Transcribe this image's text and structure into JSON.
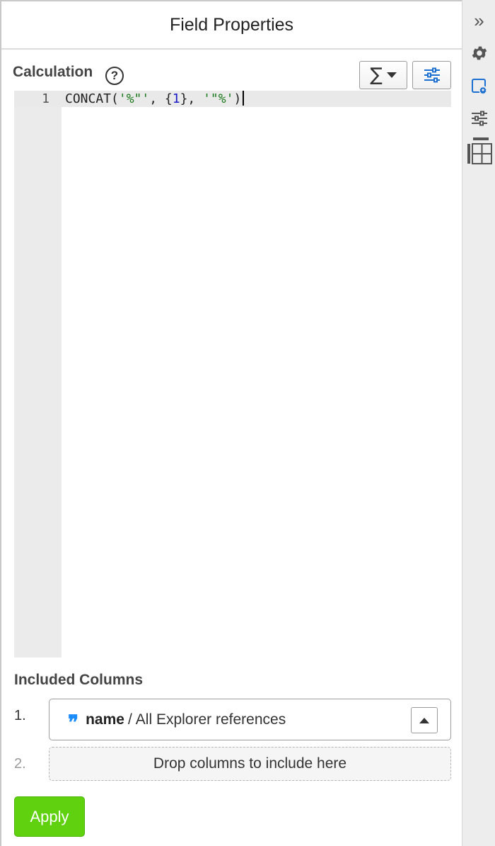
{
  "panel": {
    "title": "Field Properties"
  },
  "calculation": {
    "label": "Calculation",
    "help_glyph": "?",
    "function_menu_glyph": "∑"
  },
  "editor": {
    "line_number": "1",
    "code_tokens": {
      "func": "CONCAT(",
      "str1": "'%\"'",
      "sep1": ", {",
      "num": "1",
      "sep2": "}, ",
      "str2": "'\"%'",
      "close": ")"
    }
  },
  "included_columns": {
    "title": "Included Columns",
    "items": [
      {
        "index": "1.",
        "quote_glyph": "❞",
        "name": "name",
        "separator": "/",
        "reference": "All Explorer references"
      }
    ],
    "drop_index": "2.",
    "drop_placeholder": "Drop columns to include here"
  },
  "actions": {
    "apply_label": "Apply"
  },
  "rail": {
    "expand_glyph": "»",
    "icons": [
      "expand-icon",
      "gear-icon",
      "field-settings-icon",
      "sliders-icon",
      "table-layout-icon"
    ]
  },
  "colors": {
    "accent_blue": "#1a8cff",
    "apply_green": "#5fd10e",
    "string_green": "#1a7a1a",
    "number_blue": "#1a1ac8"
  }
}
